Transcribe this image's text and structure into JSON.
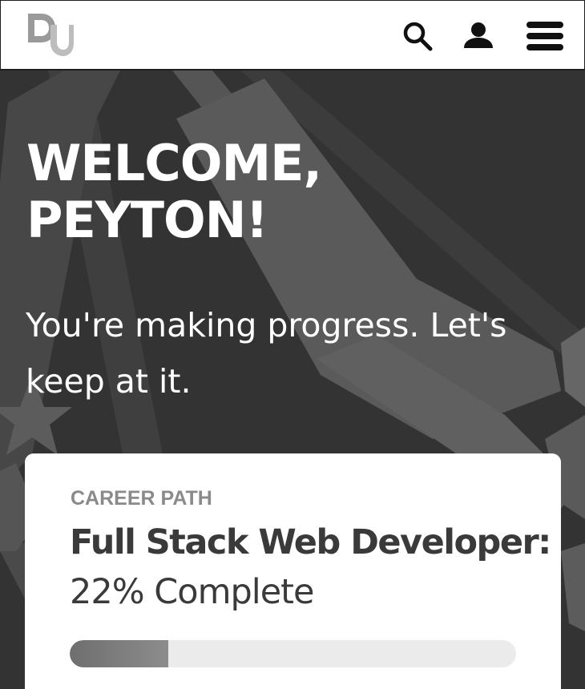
{
  "header": {
    "logo_icon": "dq-logo-icon",
    "search_icon": "search-icon",
    "account_icon": "user-icon",
    "menu_icon": "hamburger-menu-icon"
  },
  "hero": {
    "welcome_line1": "WELCOME,",
    "welcome_line2": "PEYTON!",
    "subtitle": "You're making progress. Let's keep at it."
  },
  "card": {
    "eyebrow": "CAREER PATH",
    "path_name": "Full Stack Web Developer:",
    "completion_text": "22% Complete",
    "progress_fraction": 0.22
  },
  "colors": {
    "hero_background": "#333333",
    "card_background": "#ffffff",
    "progress_fill": "#7a7a7a",
    "progress_track": "#ebebeb"
  }
}
